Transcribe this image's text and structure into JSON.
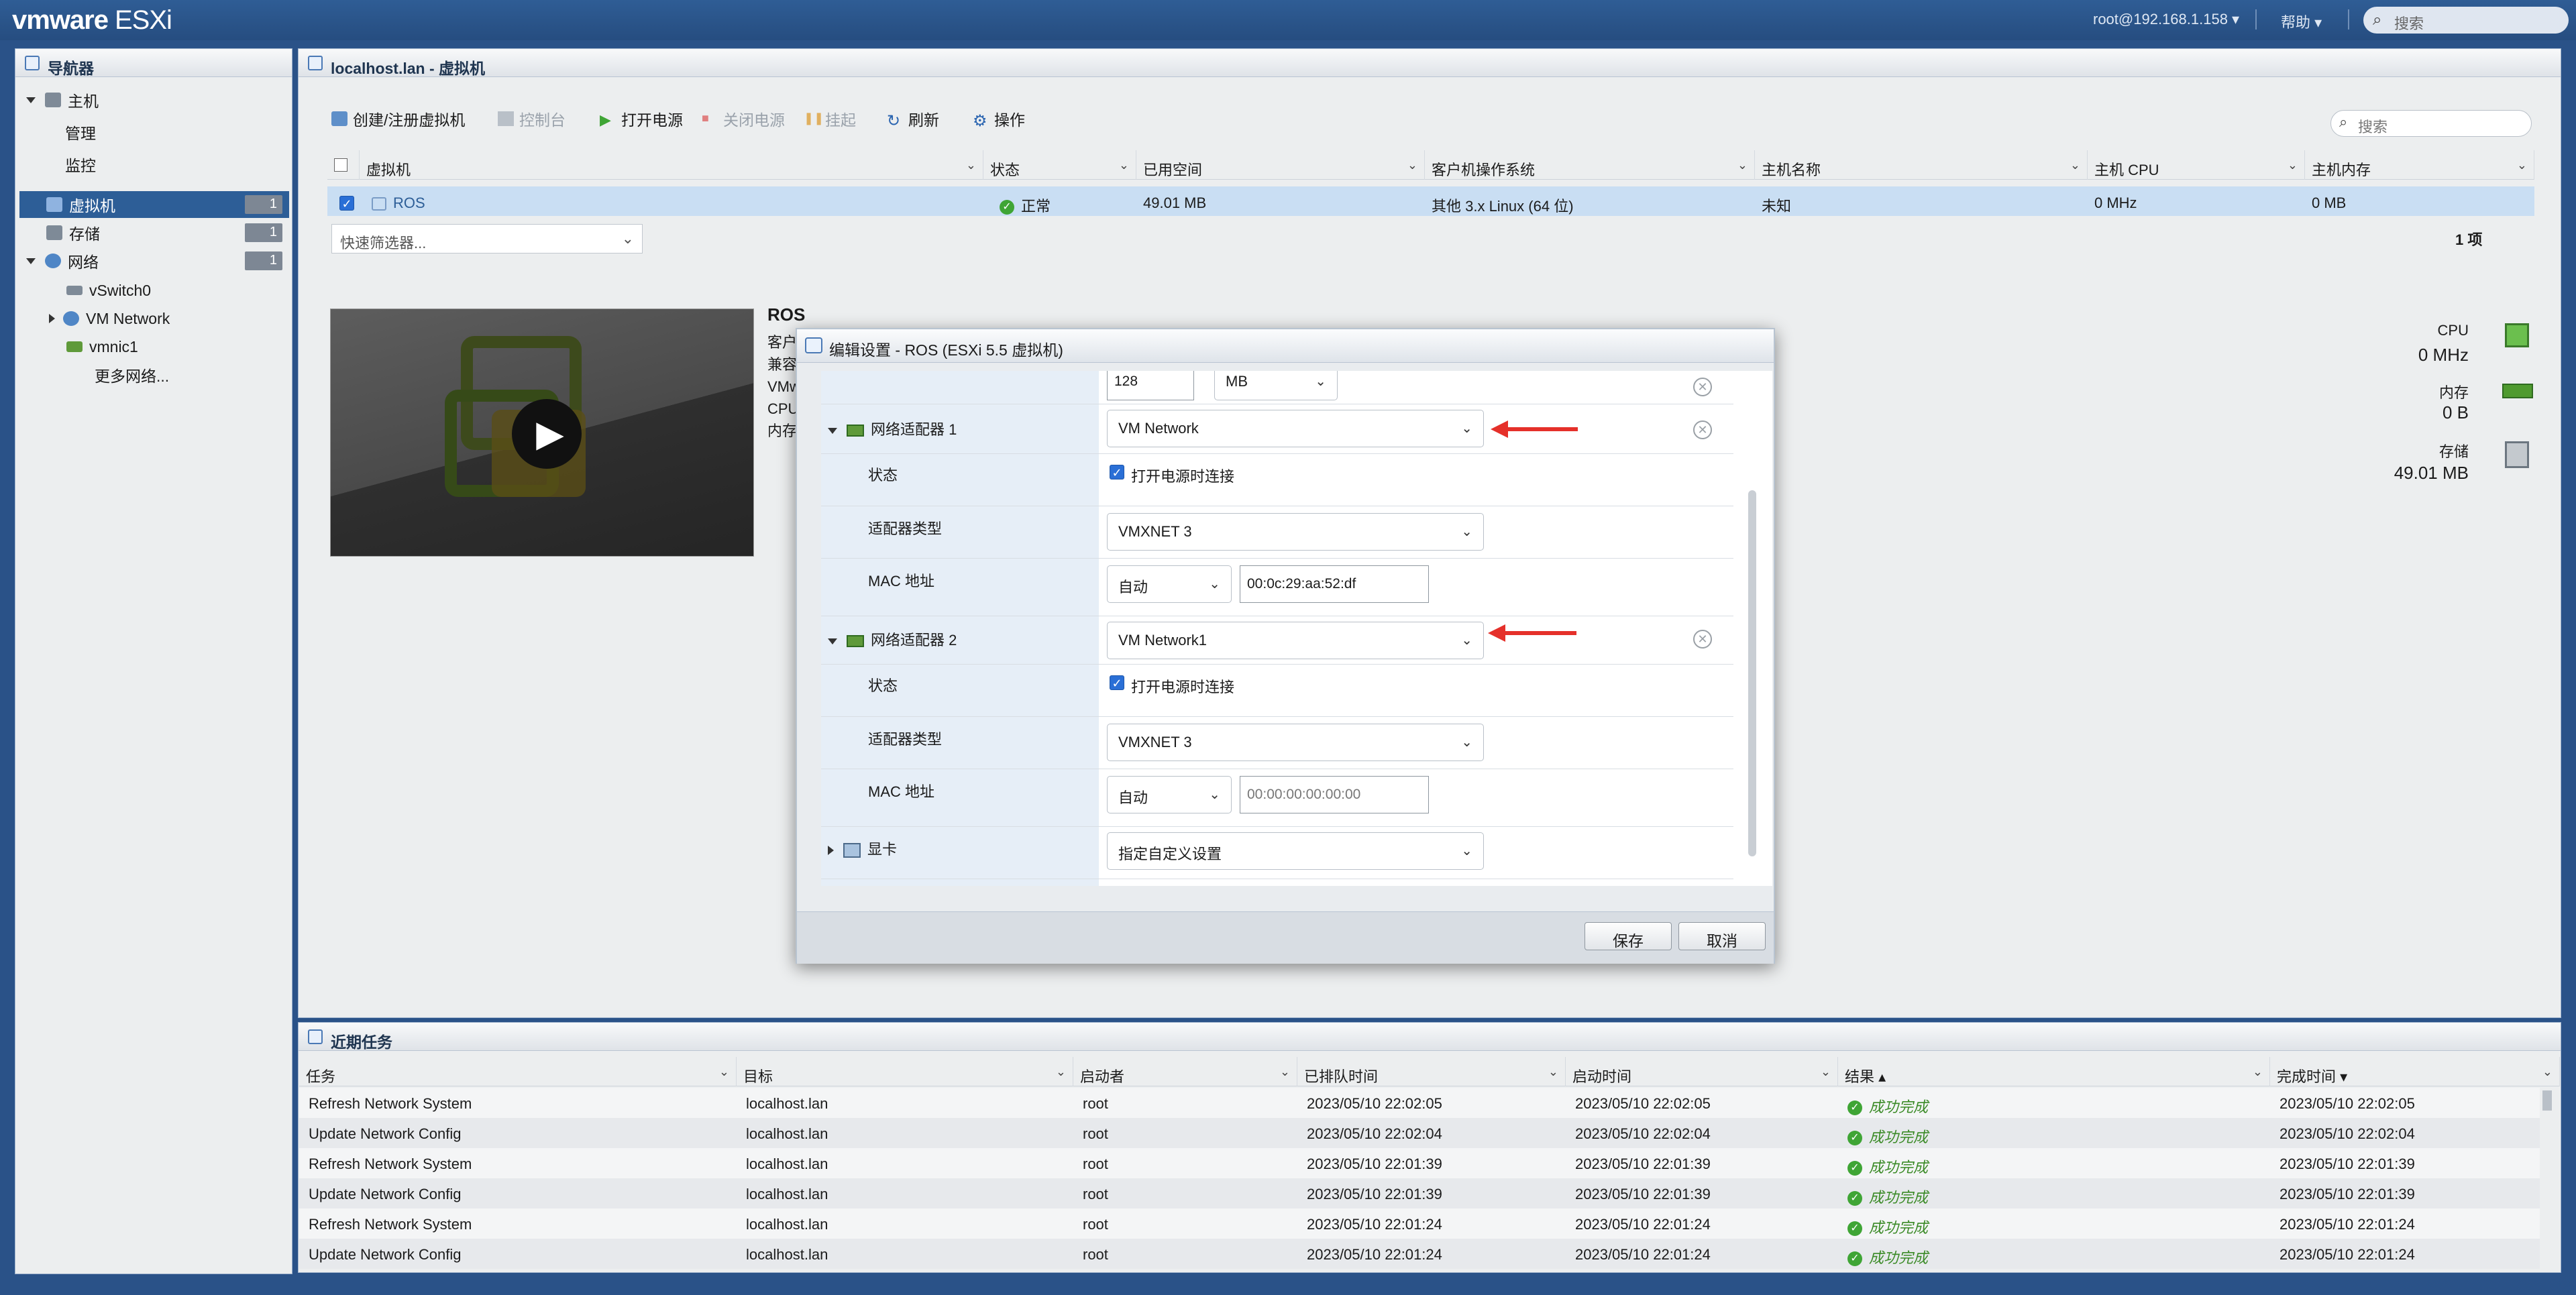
{
  "app": {
    "brand": "vmware",
    "product": "ESXi",
    "user": "root@192.168.1.158 ▾",
    "help": "帮助 ▾",
    "search_placeholder": "搜索"
  },
  "navigator": {
    "title": "导航器",
    "items": [
      {
        "label": "主机",
        "level": 0,
        "icon": "host-icon"
      },
      {
        "label": "管理",
        "level": 1
      },
      {
        "label": "监控",
        "level": 1
      },
      {
        "label": "虚拟机",
        "level": 0,
        "icon": "vm-icon",
        "badge": "1",
        "selected": true
      },
      {
        "label": "存储",
        "level": 0,
        "icon": "storage-icon",
        "badge": "1"
      },
      {
        "label": "网络",
        "level": 0,
        "icon": "network-icon",
        "badge": "1"
      },
      {
        "label": "vSwitch0",
        "level": 1,
        "icon": "vswitch-icon"
      },
      {
        "label": "VM Network",
        "level": 1,
        "icon": "portgroup-icon"
      },
      {
        "label": "vmnic1",
        "level": 1,
        "icon": "nic-icon"
      },
      {
        "label": "更多网络...",
        "level": 2
      }
    ]
  },
  "main": {
    "breadcrumb": "localhost.lan - 虚拟机",
    "toolbar": {
      "create": "创建/注册虚拟机",
      "console": "控制台",
      "power_on": "打开电源",
      "power_off": "关闭电源",
      "suspend": "挂起",
      "refresh": "刷新",
      "actions": "操作",
      "search_placeholder": "搜索"
    },
    "columns": [
      "虚拟机",
      "状态",
      "已用空间",
      "客户机操作系统",
      "主机名称",
      "主机 CPU",
      "主机内存"
    ],
    "rows": [
      {
        "name": "ROS",
        "status": "正常",
        "used": "49.01 MB",
        "guest": "其他 3.x Linux (64 位)",
        "hostname": "未知",
        "cpu": "0 MHz",
        "mem": "0 MB"
      }
    ],
    "quick_filter": "快速筛选器...",
    "count": "1 项",
    "vm_title": "ROS",
    "vm_info_labels": [
      "客户",
      "兼容",
      "VMw",
      "CPU",
      "内存"
    ],
    "perf": {
      "cpu_label": "CPU",
      "cpu_value": "0 MHz",
      "mem_label": "内存",
      "mem_value": "0 B",
      "storage_label": "存储",
      "storage_value": "49.01 MB"
    }
  },
  "dialog": {
    "title": "编辑设置 - ROS (ESXi 5.5 虚拟机)",
    "memory_value": "128",
    "memory_unit": "MB",
    "adapter1": {
      "label": "网络适配器 1",
      "network": "VM Network",
      "status_label": "状态",
      "connect_label": "打开电源时连接",
      "type_label": "适配器类型",
      "type": "VMXNET 3",
      "mac_label": "MAC 地址",
      "mac_mode": "自动",
      "mac": "00:0c:29:aa:52:df"
    },
    "adapter2": {
      "label": "网络适配器 2",
      "network": "VM Network1",
      "status_label": "状态",
      "connect_label": "打开电源时连接",
      "type_label": "适配器类型",
      "type": "VMXNET 3",
      "mac_label": "MAC 地址",
      "mac_mode": "自动",
      "mac_placeholder": "00:00:00:00:00:00"
    },
    "video": {
      "label": "显卡",
      "value": "指定自定义设置"
    },
    "save": "保存",
    "cancel": "取消"
  },
  "tasks": {
    "title": "近期任务",
    "columns": [
      "任务",
      "目标",
      "启动者",
      "已排队时间",
      "启动时间",
      "结果 ▴",
      "完成时间 ▾"
    ],
    "rows": [
      {
        "task": "Refresh Network System",
        "target": "localhost.lan",
        "initiator": "root",
        "queued": "2023/05/10 22:02:05",
        "started": "2023/05/10 22:02:05",
        "result": "成功完成",
        "completed": "2023/05/10 22:02:05"
      },
      {
        "task": "Update Network Config",
        "target": "localhost.lan",
        "initiator": "root",
        "queued": "2023/05/10 22:02:04",
        "started": "2023/05/10 22:02:04",
        "result": "成功完成",
        "completed": "2023/05/10 22:02:04"
      },
      {
        "task": "Refresh Network System",
        "target": "localhost.lan",
        "initiator": "root",
        "queued": "2023/05/10 22:01:39",
        "started": "2023/05/10 22:01:39",
        "result": "成功完成",
        "completed": "2023/05/10 22:01:39"
      },
      {
        "task": "Update Network Config",
        "target": "localhost.lan",
        "initiator": "root",
        "queued": "2023/05/10 22:01:39",
        "started": "2023/05/10 22:01:39",
        "result": "成功完成",
        "completed": "2023/05/10 22:01:39"
      },
      {
        "task": "Refresh Network System",
        "target": "localhost.lan",
        "initiator": "root",
        "queued": "2023/05/10 22:01:24",
        "started": "2023/05/10 22:01:24",
        "result": "成功完成",
        "completed": "2023/05/10 22:01:24"
      },
      {
        "task": "Update Network Config",
        "target": "localhost.lan",
        "initiator": "root",
        "queued": "2023/05/10 22:01:24",
        "started": "2023/05/10 22:01:24",
        "result": "成功完成",
        "completed": "2023/05/10 22:01:24"
      }
    ]
  },
  "colors": {
    "topbar": "#2a5288",
    "selected": "#2d5e97",
    "accent_red": "#e5302a",
    "success": "#3fa535"
  }
}
